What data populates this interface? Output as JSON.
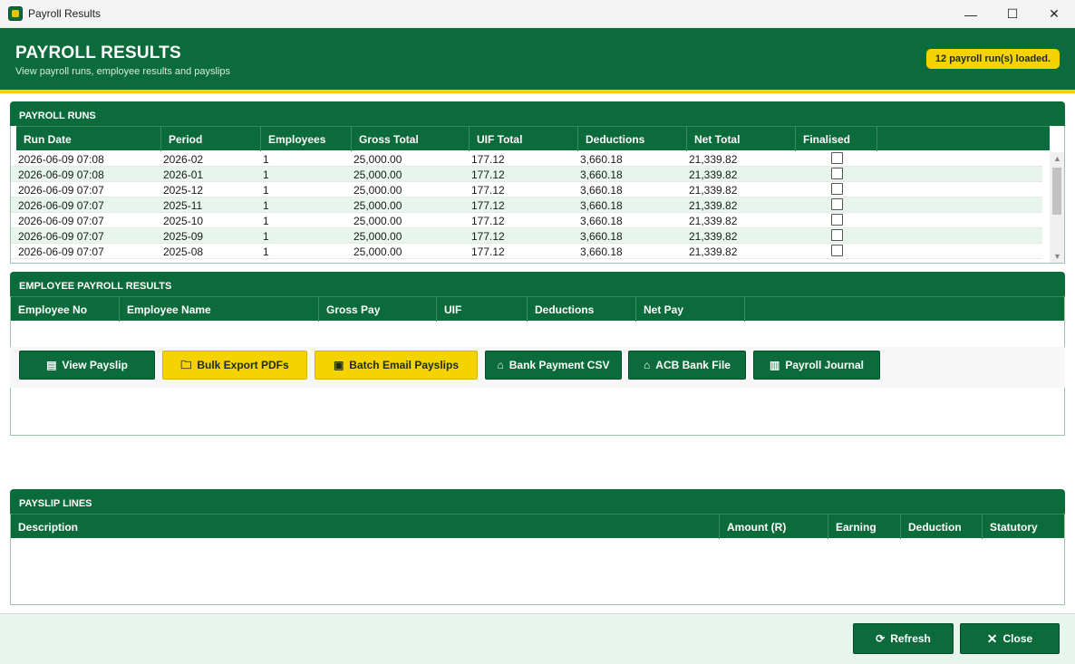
{
  "window": {
    "title": "Payroll Results",
    "controls": {
      "minimize": "—",
      "maximize": "☐",
      "close": "✕"
    }
  },
  "header": {
    "title": "PAYROLL RESULTS",
    "subtitle": "View payroll runs, employee results and payslips",
    "status": "12 payroll run(s) loaded."
  },
  "colors": {
    "brand_green": "#0b6b3a",
    "accent_yellow": "#f5d300",
    "row_alt": "#e8f5ec"
  },
  "payroll_runs": {
    "title": "PAYROLL RUNS",
    "columns": [
      "Run Date",
      "Period",
      "Employees",
      "Gross Total",
      "UIF Total",
      "Deductions",
      "Net Total",
      "Finalised"
    ],
    "rows": [
      [
        "2026-06-09 07:08",
        "2026-02",
        "1",
        "25,000.00",
        "177.12",
        "3,660.18",
        "21,339.82",
        false
      ],
      [
        "2026-06-09 07:08",
        "2026-01",
        "1",
        "25,000.00",
        "177.12",
        "3,660.18",
        "21,339.82",
        false
      ],
      [
        "2026-06-09 07:07",
        "2025-12",
        "1",
        "25,000.00",
        "177.12",
        "3,660.18",
        "21,339.82",
        false
      ],
      [
        "2026-06-09 07:07",
        "2025-11",
        "1",
        "25,000.00",
        "177.12",
        "3,660.18",
        "21,339.82",
        false
      ],
      [
        "2026-06-09 07:07",
        "2025-10",
        "1",
        "25,000.00",
        "177.12",
        "3,660.18",
        "21,339.82",
        false
      ],
      [
        "2026-06-09 07:07",
        "2025-09",
        "1",
        "25,000.00",
        "177.12",
        "3,660.18",
        "21,339.82",
        false
      ],
      [
        "2026-06-09 07:07",
        "2025-08",
        "1",
        "25,000.00",
        "177.12",
        "3,660.18",
        "21,339.82",
        false
      ]
    ]
  },
  "employee_results": {
    "title": "EMPLOYEE PAYROLL RESULTS",
    "columns": [
      "Employee No",
      "Employee Name",
      "Gross Pay",
      "UIF",
      "Deductions",
      "Net Pay"
    ]
  },
  "actions": {
    "view_payslip": "View Payslip",
    "bulk_export": "Bulk Export PDFs",
    "batch_email": "Batch Email Payslips",
    "bank_csv": "Bank Payment CSV",
    "acb_file": "ACB Bank File",
    "journal": "Payroll Journal"
  },
  "payslip_lines": {
    "title": "PAYSLIP LINES",
    "columns": [
      "Description",
      "Amount (R)",
      "Earning",
      "Deduction",
      "Statutory"
    ]
  },
  "footer": {
    "refresh": "Refresh",
    "close": "Close"
  }
}
